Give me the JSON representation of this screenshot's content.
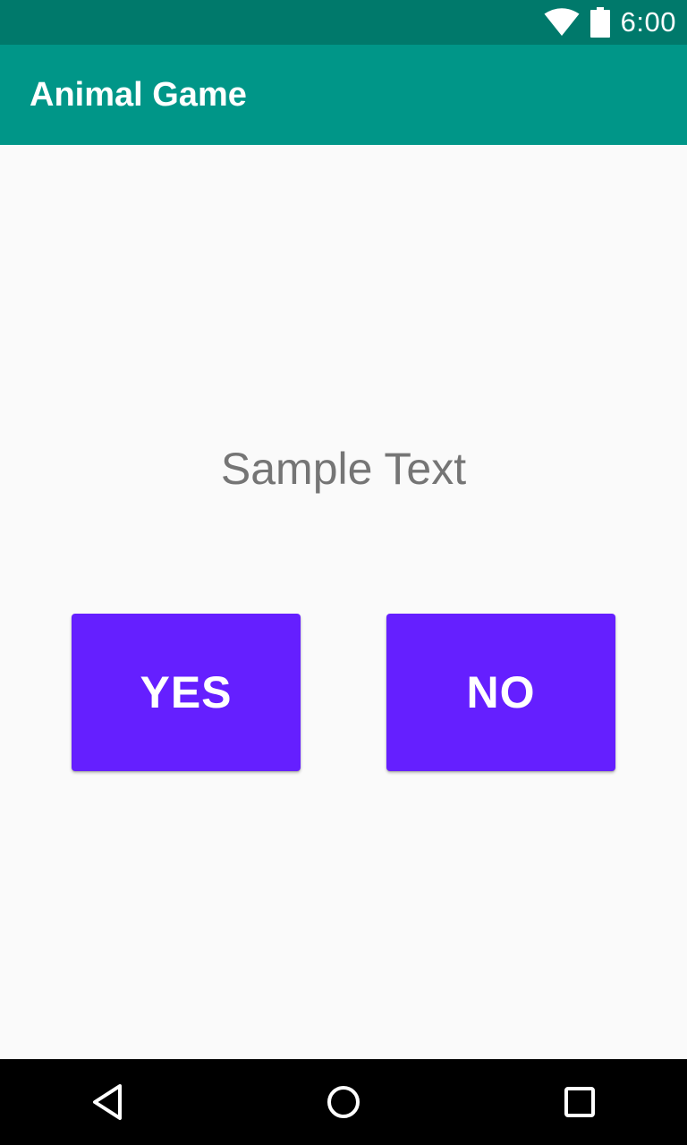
{
  "status_bar": {
    "time": "6:00",
    "icons": [
      "wifi-icon",
      "battery-icon"
    ],
    "background": "#00796b"
  },
  "app_bar": {
    "title": "Animal Game",
    "background": "#009688"
  },
  "main": {
    "prompt_text": "Sample Text",
    "yes_label": "YES",
    "no_label": "NO",
    "button_color": "#651fff"
  },
  "nav_bar": {
    "icons": [
      "back-icon",
      "home-icon",
      "recent-apps-icon"
    ]
  }
}
